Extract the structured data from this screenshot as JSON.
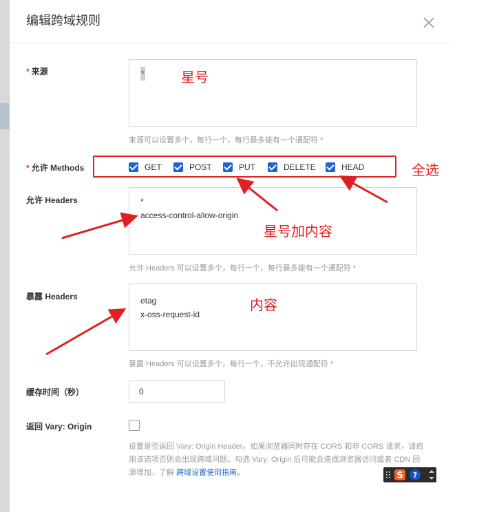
{
  "dialog": {
    "title": "编辑跨域规则"
  },
  "origin": {
    "label": "来源",
    "required_mark": "*",
    "value": "*",
    "hint": "来源可以设置多个，每行一个，每行最多能有一个通配符 *"
  },
  "methods": {
    "label": "允许 Methods",
    "required_mark": "*",
    "items": [
      {
        "label": "GET",
        "checked": true
      },
      {
        "label": "POST",
        "checked": true
      },
      {
        "label": "PUT",
        "checked": true
      },
      {
        "label": "DELETE",
        "checked": true
      },
      {
        "label": "HEAD",
        "checked": true
      }
    ]
  },
  "allow_headers": {
    "label": "允许 Headers",
    "lines": [
      "*",
      "access-control-allow-origin"
    ],
    "hint": "允许 Headers 可以设置多个，每行一个，每行最多能有一个通配符 *"
  },
  "expose_headers": {
    "label": "暴露 Headers",
    "lines": [
      "etag",
      "x-oss-request-id"
    ],
    "hint": "暴露 Headers 可以设置多个，每行一个，不允许出现通配符 *"
  },
  "cache": {
    "label": "缓存时间（秒）",
    "value": "0"
  },
  "vary": {
    "label": "返回 Vary: Origin",
    "checked": false,
    "description": "设置是否返回 Vary: Origin Header。如果浏览器同时存在 CORS 和非 CORS 请求，请启用该选项否则会出现跨域问题。勾选 Vary: Origin 后可能会造成浏览器访问或者 CDN 回源增加，了解",
    "link_text": "跨域设置使用指南。"
  },
  "annotations": {
    "star": "星号",
    "select_all": "全选",
    "star_plus_content": "星号加内容",
    "content": "内容"
  },
  "colors": {
    "annotation_red": "#e02020",
    "checkbox_blue": "#1c64d1",
    "hint_gray": "#999999"
  },
  "ime_toolbar": {
    "icons": [
      "grip-icon",
      "sogou-s-icon",
      "help-icon",
      "menu-icon"
    ]
  }
}
